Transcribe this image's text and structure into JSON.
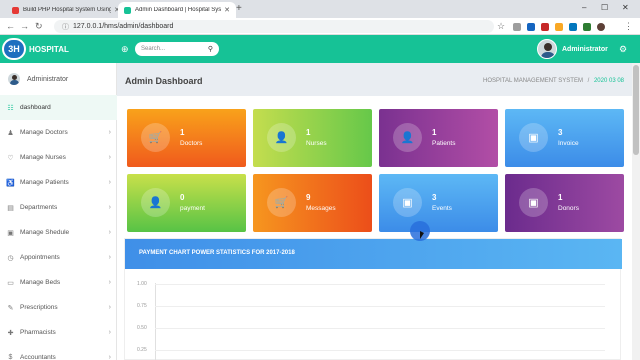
{
  "browser": {
    "tabs": [
      {
        "title": "Build PHP Hospital System Using",
        "active": false,
        "favicon_color": "#e53935"
      },
      {
        "title": "Admin Dashboard | Hospital Sys",
        "active": true,
        "favicon_color": "#16c296"
      }
    ],
    "new_tab": "+",
    "url": "127.0.0.1/hms/admin/dashboard"
  },
  "header": {
    "logo_mark": "3H",
    "logo_text": "HOSPITAL",
    "search_placeholder": "Search...",
    "user_name": "Administrator"
  },
  "sidebar": {
    "user_name": "Administrator",
    "items": [
      {
        "label": "dashboard",
        "icon": "dashboard-icon",
        "glyph": "☷",
        "active": true,
        "chevron": false
      },
      {
        "label": "Manage Doctors",
        "icon": "doctor-icon",
        "glyph": "♟",
        "active": false,
        "chevron": true
      },
      {
        "label": "Manage Nurses",
        "icon": "nurse-icon",
        "glyph": "♡",
        "active": false,
        "chevron": true
      },
      {
        "label": "Manage Patients",
        "icon": "patient-icon",
        "glyph": "♿",
        "active": false,
        "chevron": true
      },
      {
        "label": "Departments",
        "icon": "building-icon",
        "glyph": "▤",
        "active": false,
        "chevron": true
      },
      {
        "label": "Manage Shedule",
        "icon": "calendar-icon",
        "glyph": "▣",
        "active": false,
        "chevron": true
      },
      {
        "label": "Appointments",
        "icon": "appointment-icon",
        "glyph": "◷",
        "active": false,
        "chevron": true
      },
      {
        "label": "Manage Beds",
        "icon": "bed-icon",
        "glyph": "▭",
        "active": false,
        "chevron": true
      },
      {
        "label": "Prescriptions",
        "icon": "prescription-icon",
        "glyph": "✎",
        "active": false,
        "chevron": true
      },
      {
        "label": "Pharmacists",
        "icon": "pharmacist-icon",
        "glyph": "✚",
        "active": false,
        "chevron": true
      },
      {
        "label": "Accountants",
        "icon": "accountant-icon",
        "glyph": "$",
        "active": false,
        "chevron": true
      }
    ]
  },
  "main": {
    "title": "Admin Dashboard",
    "breadcrumb": [
      "HOSPITAL MANAGEMENT SYSTEM",
      "/",
      "2020 03 08"
    ],
    "cards": [
      {
        "value": "1",
        "label": "Doctors",
        "icon": "cart-icon",
        "glyph": "🛒",
        "gradient": "g-orange"
      },
      {
        "value": "1",
        "label": "Nurses",
        "icon": "user-icon",
        "glyph": "👤",
        "gradient": "g-green"
      },
      {
        "value": "1",
        "label": "Patients",
        "icon": "user-icon",
        "glyph": "👤",
        "gradient": "g-purple"
      },
      {
        "value": "3",
        "label": "Invoice",
        "icon": "wallet-icon",
        "glyph": "▣",
        "gradient": "g-blue"
      },
      {
        "value": "0",
        "label": "payment",
        "icon": "user-icon",
        "glyph": "👤",
        "gradient": "g-yellowgreen"
      },
      {
        "value": "9",
        "label": "Messages",
        "icon": "cart-icon",
        "glyph": "🛒",
        "gradient": "g-orange2"
      },
      {
        "value": "3",
        "label": "Events",
        "icon": "wallet-icon",
        "glyph": "▣",
        "gradient": "g-blue"
      },
      {
        "value": "1",
        "label": "Donors",
        "icon": "wallet-icon",
        "glyph": "▣",
        "gradient": "g-purple2"
      }
    ],
    "chart_title": "PAYMENT CHART POWER STATISTICS FOR 2017-2018"
  },
  "chart_data": {
    "type": "bar",
    "title": "PAYMENT CHART POWER STATISTICS FOR 2017-2018",
    "categories": [],
    "values": [],
    "yticks": [
      "1.00",
      "0.75",
      "0.50",
      "0.25"
    ],
    "ylim": [
      0,
      1
    ],
    "grid": true
  }
}
